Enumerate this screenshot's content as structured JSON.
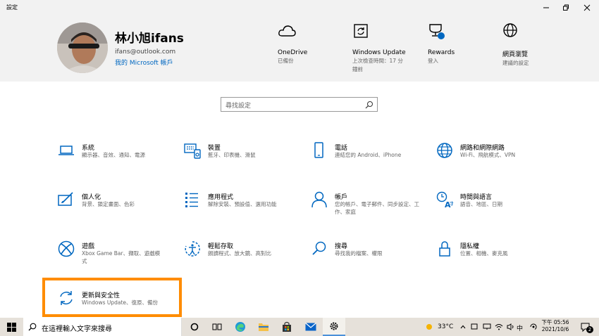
{
  "window": {
    "title": "設定"
  },
  "user": {
    "name": "林小旭ifans",
    "email": "ifans@outlook.com",
    "account_link": "我的 Microsoft 帳戶"
  },
  "header_items": [
    {
      "title": "OneDrive",
      "sub": [
        "已備份"
      ],
      "icon": "cloud-icon"
    },
    {
      "title": "Windows Update",
      "sub": [
        "上次檢查時間：17 分",
        "鐘前"
      ],
      "icon": "update-icon"
    },
    {
      "title": "Rewards",
      "sub": [
        "登入"
      ],
      "icon": "trophy-icon"
    },
    {
      "title": "網頁瀏覽",
      "sub": [
        "建議的設定"
      ],
      "icon": "globe-icon"
    }
  ],
  "search": {
    "placeholder": "尋找設定"
  },
  "categories": [
    {
      "title": "系統",
      "sub": "顯示器、音效、通知、電源",
      "icon": "laptop-icon"
    },
    {
      "title": "裝置",
      "sub": "藍牙、印表機、滑鼠",
      "icon": "keyboard-icon"
    },
    {
      "title": "電話",
      "sub": "連結您的 Android、iPhone",
      "icon": "phone-icon"
    },
    {
      "title": "網路和網際網路",
      "sub": "Wi-Fi、飛航模式、VPN",
      "icon": "globe-icon"
    },
    {
      "title": "個人化",
      "sub": "背景、鎖定畫面、色彩",
      "icon": "paint-icon"
    },
    {
      "title": "應用程式",
      "sub": "解除安裝、預設值、選用功能",
      "icon": "apps-list-icon"
    },
    {
      "title": "帳戶",
      "sub": "您的帳戶、電子郵件、同步設定、工作、家庭",
      "icon": "person-icon"
    },
    {
      "title": "時間與語言",
      "sub": "語音、地區、日期",
      "icon": "time-language-icon"
    },
    {
      "title": "遊戲",
      "sub": "Xbox Game Bar、擷取、遊戲模式",
      "icon": "xbox-icon"
    },
    {
      "title": "輕鬆存取",
      "sub": "朗讀程式、放大鏡、高對比",
      "icon": "ease-of-access-icon"
    },
    {
      "title": "搜尋",
      "sub": "尋找我的檔案、權限",
      "icon": "search-icon"
    },
    {
      "title": "隱私權",
      "sub": "位置、相機、麥克風",
      "icon": "lock-icon"
    },
    {
      "title": "更新與安全性",
      "sub": "Windows Update、復原、備份",
      "icon": "sync-icon"
    }
  ],
  "taskbar": {
    "search_placeholder": "在這裡輸入文字來搜尋",
    "weather": "33°C",
    "ime": "中",
    "time": "下午 05:56",
    "date": "2021/10/6",
    "notification_count": "2"
  },
  "colors": {
    "accent": "#0067c0",
    "highlight": "#ff8c00",
    "header_bg": "#f2f2f2"
  }
}
